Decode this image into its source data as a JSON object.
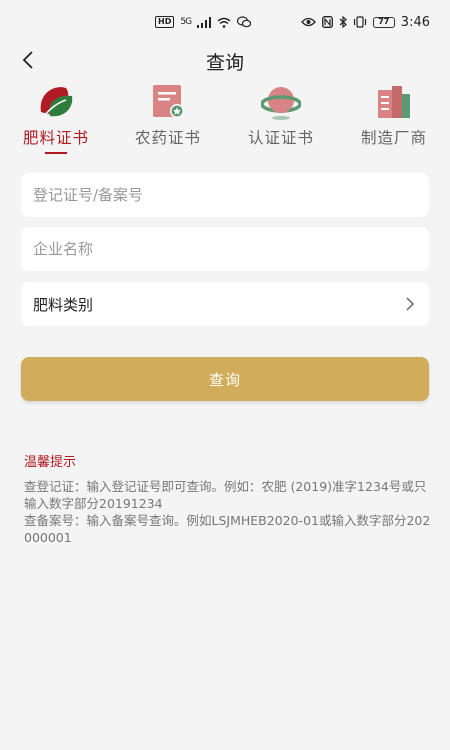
{
  "status_bar": {
    "hd": "HD",
    "signal": "5G",
    "battery": "77",
    "time": "3:46"
  },
  "nav": {
    "title": "查询"
  },
  "tabs": [
    {
      "label": "肥料证书",
      "icon": "fertilizer-leaf-icon",
      "active": true
    },
    {
      "label": "农药证书",
      "icon": "certificate-icon",
      "active": false
    },
    {
      "label": "认证证书",
      "icon": "globe-ring-icon",
      "active": false
    },
    {
      "label": "制造厂商",
      "icon": "buildings-icon",
      "active": false
    }
  ],
  "form": {
    "reg_number_placeholder": "登记证号/备案号",
    "company_placeholder": "企业名称",
    "category_label": "肥料类别",
    "submit_label": "查询"
  },
  "tips": {
    "title": "温馨提示",
    "body": "查登记证：输入登记证号即可查询。例如：农肥 (2019)准字1234号或只输入数字部分20191234\n查备案号：输入备案号查询。例如LSJMHEB2020-01或输入数字部分202000001"
  },
  "colors": {
    "accent_red": "#b11b24",
    "button_gold": "#d0ac5b",
    "background": "#f4f4f4"
  }
}
